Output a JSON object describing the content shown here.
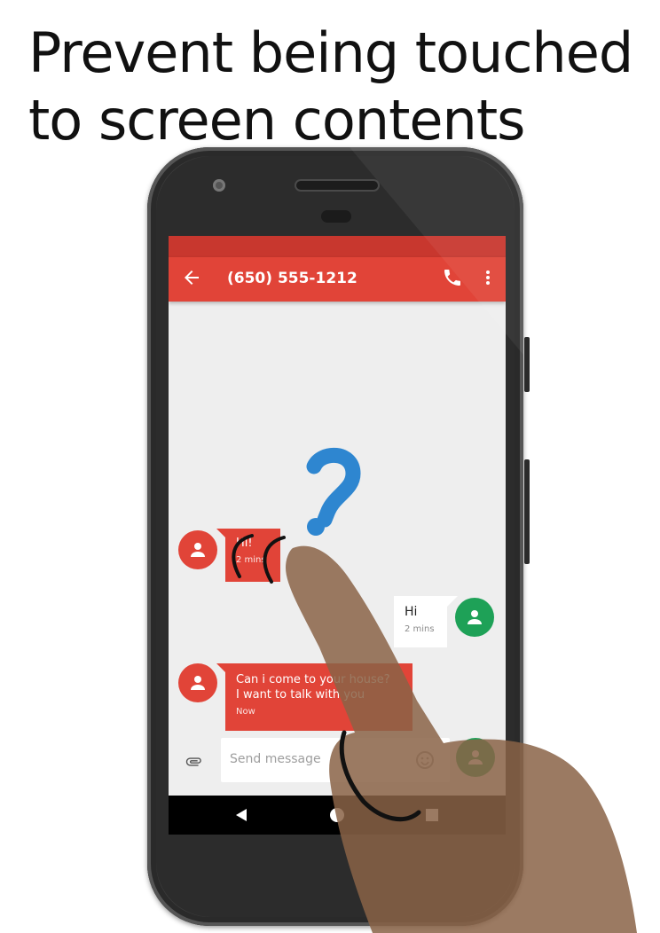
{
  "headline": "Prevent being touched to screen contents",
  "app": {
    "contact_number": "(650) 555-1212",
    "composer_placeholder": "Send message"
  },
  "messages": [
    {
      "direction": "incoming",
      "text": "Hi!",
      "time": "2 mins"
    },
    {
      "direction": "outgoing",
      "text": "Hi",
      "time": "2 mins"
    },
    {
      "direction": "incoming",
      "text_line1": "Can i come to your house?",
      "text_line2": "I want to talk with you",
      "time": "Now"
    }
  ],
  "icons": {
    "back": "arrow-back-icon",
    "call": "phone-icon",
    "overflow": "more-vert-icon",
    "attach": "paperclip-icon",
    "emoji": "emoji-icon",
    "avatar": "person-icon",
    "question": "question-mark-icon",
    "finger": "finger-icon"
  },
  "colors": {
    "appbar": "#e14438",
    "statusbar": "#c8372e",
    "incoming_bubble": "#e14438",
    "outgoing_avatar": "#1ea157",
    "question_mark": "#2e86d0",
    "finger": "#8a6346"
  }
}
